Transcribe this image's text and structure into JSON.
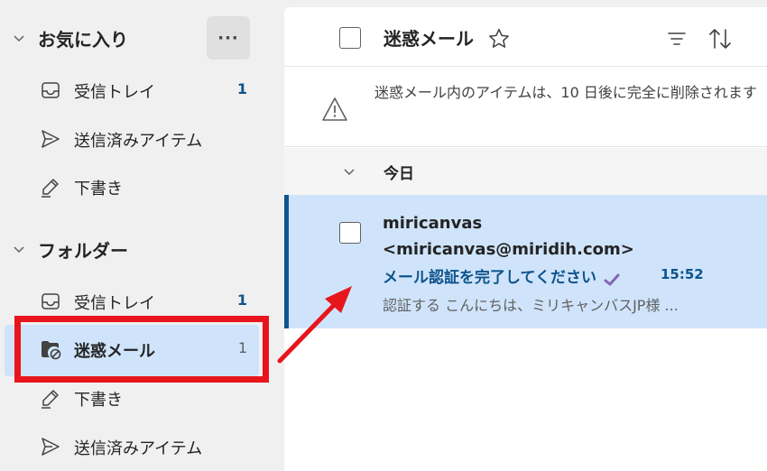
{
  "sidebar": {
    "favorites": {
      "title": "お気に入り",
      "more_label": "···",
      "items": [
        {
          "label": "受信トレイ",
          "count": "1",
          "icon": "inbox-icon"
        },
        {
          "label": "送信済みアイテム",
          "count": "",
          "icon": "send-icon"
        },
        {
          "label": "下書き",
          "count": "",
          "icon": "draft-icon"
        }
      ]
    },
    "folders": {
      "title": "フォルダー",
      "items": [
        {
          "label": "受信トレイ",
          "count": "1",
          "icon": "inbox-icon"
        },
        {
          "label": "迷惑メール",
          "count": "1",
          "icon": "junk-folder-icon",
          "selected": true
        },
        {
          "label": "下書き",
          "count": "",
          "icon": "draft-icon"
        },
        {
          "label": "送信済みアイテム",
          "count": "",
          "icon": "send-icon"
        }
      ]
    }
  },
  "list": {
    "title": "迷惑メール",
    "notice": "迷惑メール内のアイテムは、10 日後に完全に削除されます",
    "group_label": "今日",
    "messages": [
      {
        "sender": "miricanvas <miricanvas@miridih.com>",
        "subject": "メール認証を完了してください",
        "time": "15:52",
        "preview": "認証する こんにちは、ミリキャンバスJP様 ..."
      }
    ]
  },
  "colors": {
    "accent": "#0f548c",
    "selected_bg": "#cfe4fa",
    "highlight": "#e8151c",
    "check": "#8764b8"
  }
}
